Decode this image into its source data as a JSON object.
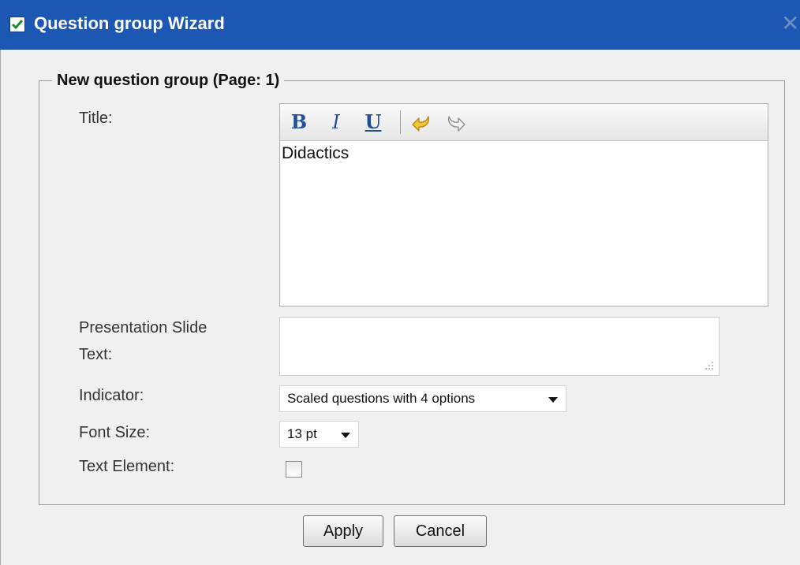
{
  "window": {
    "title": "Question group Wizard",
    "close_glyph": "✕"
  },
  "group": {
    "legend": "New question group (Page: 1)"
  },
  "fields": {
    "title_label": "Title:",
    "title_value": "Didactics",
    "slide_label_line1": "Presentation Slide",
    "slide_label_line2": "Text:",
    "slide_value": "",
    "indicator_label": "Indicator:",
    "indicator_value": "Scaled questions with 4 options",
    "font_size_label": "Font Size:",
    "font_size_value": "13 pt",
    "text_element_label": "Text Element:",
    "text_element_checked": false
  },
  "toolbar": {
    "bold": "B",
    "italic": "I",
    "underline": "U",
    "undo_icon": "undo-icon",
    "redo_icon": "redo-icon"
  },
  "buttons": {
    "apply": "Apply",
    "cancel": "Cancel"
  },
  "colors": {
    "titlebar": "#1c57b3",
    "background": "#f0f0f0"
  }
}
